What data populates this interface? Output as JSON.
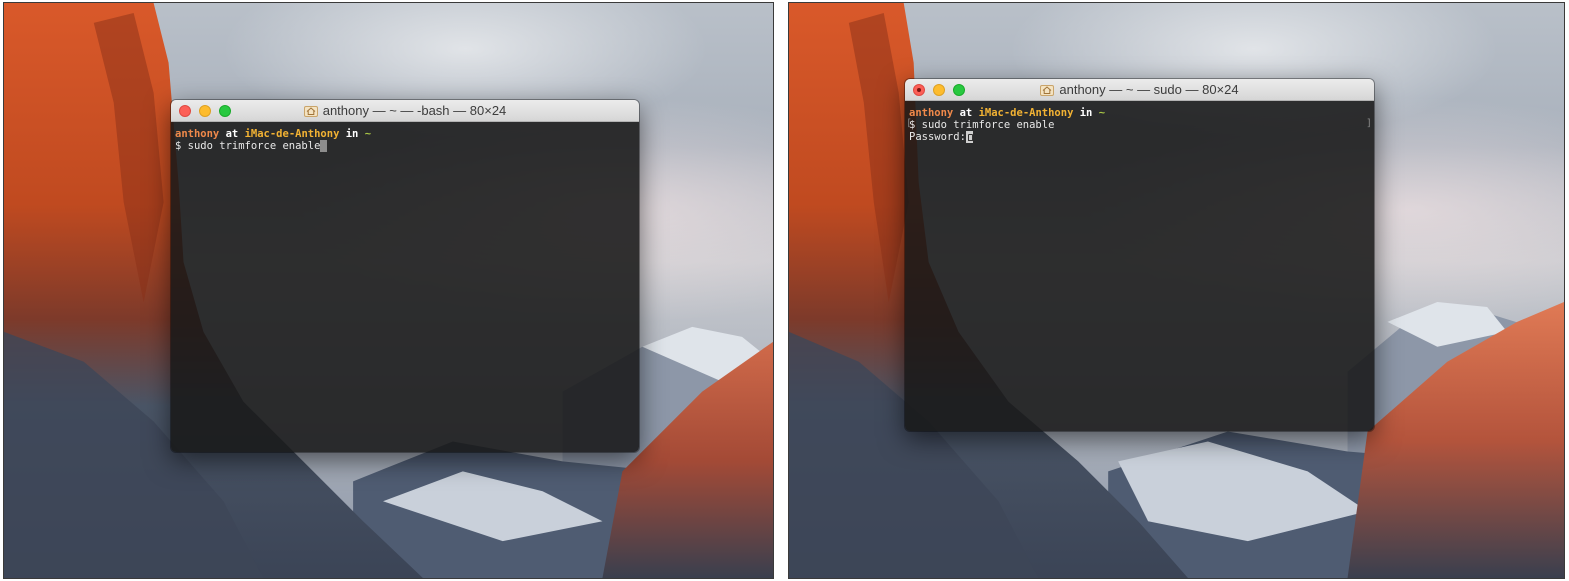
{
  "left_window": {
    "title": "anthony — ~ — -bash — 80×24",
    "prompt": {
      "user": "anthony",
      "at": " at ",
      "host": "iMac-de-Anthony",
      "in": " in ",
      "dir": "~"
    },
    "command_line": "$ sudo trimforce enable"
  },
  "right_window": {
    "title": "anthony — ~ — sudo — 80×24",
    "prompt": {
      "user": "anthony",
      "at": " at ",
      "host": "iMac-de-Anthony",
      "in": " in ",
      "dir": "~"
    },
    "command_line": "$ sudo trimforce enable",
    "password_label": "Password:"
  },
  "colors": {
    "user": "#f0894a",
    "host": "#f2b233",
    "dir": "#a8c545",
    "terminal_bg": "#181818"
  },
  "icons": [
    "home-folder-icon",
    "close-button",
    "minimize-button",
    "zoom-button"
  ]
}
